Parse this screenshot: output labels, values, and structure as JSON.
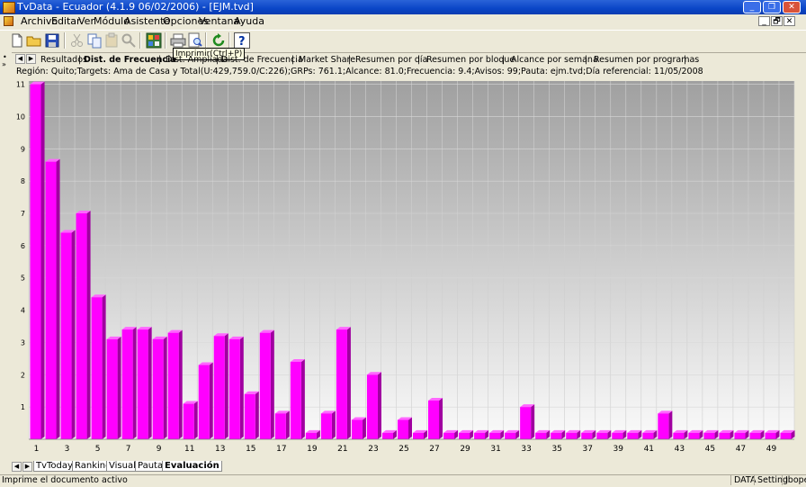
{
  "window": {
    "title": "TvData - Ecuador (4.1.9 06/02/2006) - [EJM.tvd]",
    "minimize": "_",
    "restore": "❐",
    "close": "✕"
  },
  "menu": [
    "Archivo",
    "Editar",
    "Ver",
    "Módulo",
    "Asistente",
    "Opciones",
    "Ventana",
    "Ayuda"
  ],
  "mdi_controls": [
    "_",
    "🗗",
    "✕"
  ],
  "toolbar_icons": [
    "new-document-icon",
    "open-folder-icon",
    "save-icon",
    "cut-icon",
    "copy-icon",
    "paste-icon",
    "find-icon",
    "calculator-icon",
    "print-icon",
    "print-preview-icon",
    "refresh-icon",
    "help-icon"
  ],
  "tooltip": "Imprimir(Ctrl+P)",
  "tabs": [
    "Resultados",
    "Dist. de Frecuencia",
    "Dist. Ampliada",
    "Dist. de Frecuencia",
    "Market Share",
    "Resumen por día",
    "Resumen por bloque",
    "Alcance por semana",
    "Resumen por programas"
  ],
  "active_tab": 1,
  "info": "Región: Quito;Targets: Ama de Casa y Total(U:429,759.0/C:226);GRPs: 761.1;Alcance: 81.0;Frecuencia: 9.4;Avisos: 99;Pauta: ejm.tvd;Día referencial: 11/05/2008",
  "bottom_tabs": [
    "TvToday",
    "Ranking",
    "Visual",
    "Pauta",
    "Evaluación"
  ],
  "active_bottom_tab": 4,
  "status": {
    "message": "Imprime el documento activo",
    "panels": [
      "DATA",
      "Setting",
      "Ibope"
    ]
  },
  "colors": {
    "bar": "#ff00ff",
    "bar_top": "#ff66ff",
    "bar_side": "#a000a0",
    "accent": "#0a45c7"
  },
  "chart_data": {
    "type": "bar",
    "x": [
      1,
      2,
      3,
      4,
      5,
      6,
      7,
      8,
      9,
      10,
      11,
      12,
      13,
      14,
      15,
      16,
      17,
      18,
      19,
      20,
      21,
      22,
      23,
      24,
      25,
      26,
      27,
      28,
      29,
      30,
      31,
      32,
      33,
      34,
      35,
      36,
      37,
      38,
      39,
      40,
      41,
      42,
      43,
      44,
      45,
      46,
      47,
      48,
      49,
      50
    ],
    "values": [
      11.0,
      8.6,
      6.4,
      7.0,
      4.4,
      3.1,
      3.4,
      3.4,
      3.1,
      3.3,
      1.1,
      2.3,
      3.2,
      3.1,
      1.4,
      3.3,
      0.8,
      2.4,
      0.2,
      0.8,
      3.4,
      0.6,
      2.0,
      0.2,
      0.6,
      0.2,
      1.2,
      0.2,
      0.2,
      0.2,
      0.2,
      0.2,
      1.0,
      0.2,
      0.2,
      0.2,
      0.2,
      0.2,
      0.2,
      0.2,
      0.2,
      0.8,
      0.2,
      0.2,
      0.2,
      0.2,
      0.2,
      0.2,
      0.2,
      0.2
    ],
    "xticks": [
      1,
      3,
      5,
      7,
      9,
      11,
      13,
      15,
      17,
      19,
      21,
      23,
      25,
      27,
      29,
      31,
      33,
      35,
      37,
      39,
      41,
      43,
      45,
      47,
      49
    ],
    "yticks": [
      1,
      2,
      3,
      4,
      5,
      6,
      7,
      8,
      9,
      10,
      11
    ],
    "ylim": [
      0,
      11.1
    ],
    "grid": true
  }
}
